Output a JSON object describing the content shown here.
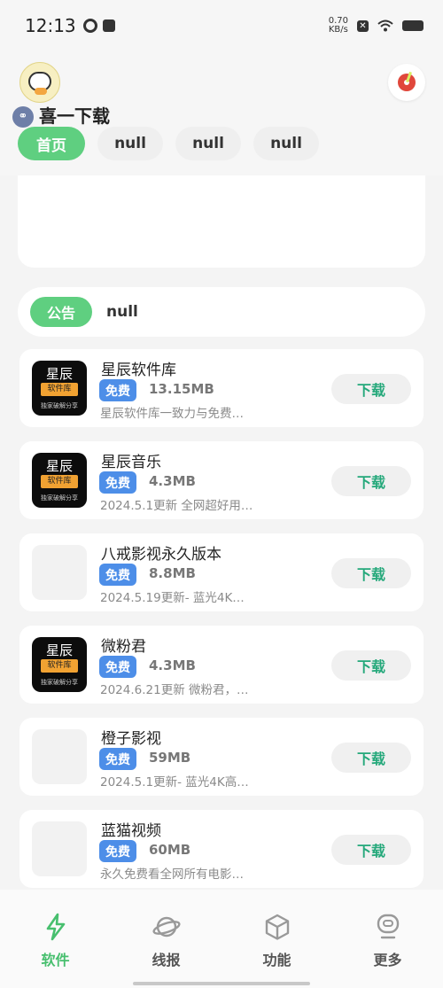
{
  "status_bar": {
    "time": "12:13",
    "net_speed_value": "0.70",
    "net_speed_unit": "KB/s"
  },
  "header": {
    "app_title": "喜一下载"
  },
  "tabs": [
    "首页",
    "null",
    "null",
    "null"
  ],
  "notice": {
    "label": "公告",
    "text": "null"
  },
  "apps": [
    {
      "name": "星辰软件库",
      "badge": "免费",
      "size": "13.15MB",
      "desc": "星辰软件库一致力与免费…",
      "button": "下载",
      "icon": "xingchen-logo"
    },
    {
      "name": "星辰音乐",
      "badge": "免费",
      "size": "4.3MB",
      "desc": "2024.5.1更新 全网超好用…",
      "button": "下载",
      "icon": "xingchen-logo"
    },
    {
      "name": "八戒影视永久版本",
      "badge": "免费",
      "size": "8.8MB",
      "desc": "2024.5.19更新- 蓝光4K…",
      "button": "下载",
      "icon": "placeholder"
    },
    {
      "name": "微粉君",
      "badge": "免费",
      "size": "4.3MB",
      "desc": "2024.6.21更新 微粉君，…",
      "button": "下载",
      "icon": "xingchen-logo"
    },
    {
      "name": "橙子影视",
      "badge": "免费",
      "size": "59MB",
      "desc": "2024.5.1更新- 蓝光4K高…",
      "button": "下载",
      "icon": "placeholder"
    },
    {
      "name": "蓝猫视频",
      "badge": "免费",
      "size": "60MB",
      "desc": "永久免费看全网所有电影…",
      "button": "下载",
      "icon": "placeholder"
    }
  ],
  "logo": {
    "title": "星辰",
    "badge": "软件库",
    "sub": "独家破解分享"
  },
  "bottom_nav": [
    {
      "label": "软件",
      "icon": "lightning-icon"
    },
    {
      "label": "线报",
      "icon": "planet-icon"
    },
    {
      "label": "功能",
      "icon": "cube-icon"
    },
    {
      "label": "更多",
      "icon": "robot-icon"
    }
  ],
  "colors": {
    "accent_green": "#5fcf80",
    "badge_blue": "#4d8ee8",
    "download_text": "#24a87a"
  }
}
